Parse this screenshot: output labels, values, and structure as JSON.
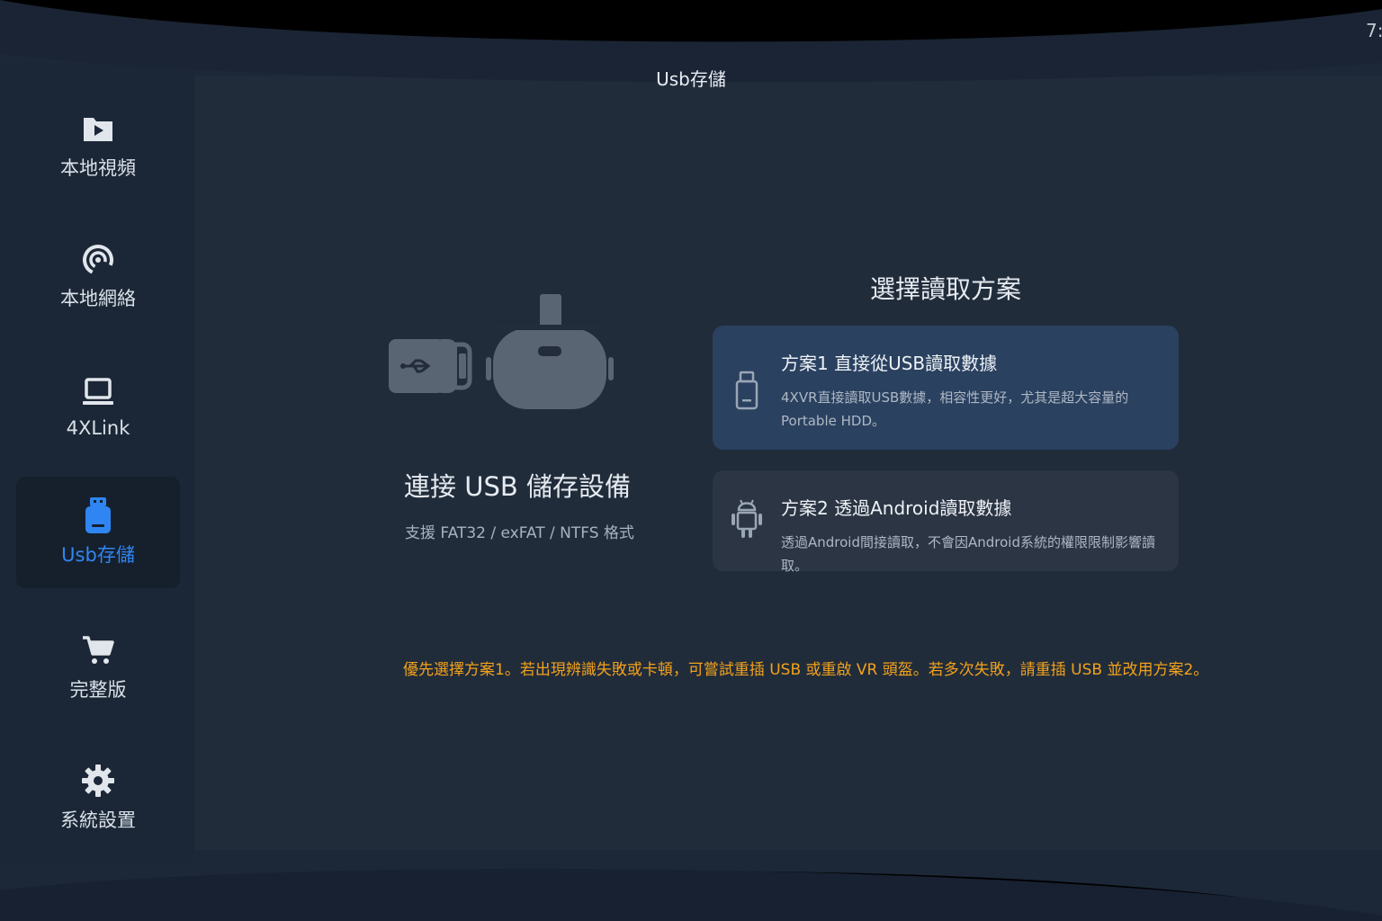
{
  "window": {
    "title": "Usb存儲",
    "clock": "7:"
  },
  "sidebar": {
    "items": [
      {
        "label": "本地視頻",
        "icon": "folder-play-icon"
      },
      {
        "label": "本地網絡",
        "icon": "network-signal-icon"
      },
      {
        "label": "4XLink",
        "icon": "laptop-icon"
      },
      {
        "label": "Usb存儲",
        "icon": "usb-drive-icon",
        "active": true
      },
      {
        "label": "完整版",
        "icon": "cart-icon"
      },
      {
        "label": "系統設置",
        "icon": "gear-icon"
      }
    ]
  },
  "main": {
    "connect_title": "連接 USB 儲存設備",
    "connect_subtitle": "支援 FAT32 / exFAT / NTFS 格式",
    "choose_title": "選擇讀取方案",
    "options": [
      {
        "title": "方案1 直接從USB讀取數據",
        "description": "4XVR直接讀取USB數據，相容性更好，尤其是超大容量的Portable HDD。",
        "icon": "usb-stick-icon",
        "selected": true
      },
      {
        "title": "方案2 透過Android讀取數據",
        "description": "透過Android間接讀取，不會因Android系統的權限限制影響讀取。",
        "icon": "android-icon",
        "selected": false
      }
    ],
    "notice": "優先選擇方案1。若出現辨識失敗或卡頓，可嘗試重插 USB 或重啟 VR 頭盔。若多次失敗，請重插 USB 並改用方案2。"
  },
  "colors": {
    "accent": "#2f86f2",
    "warning": "#f2a21a",
    "selected_option_bg": "#2a4160"
  }
}
